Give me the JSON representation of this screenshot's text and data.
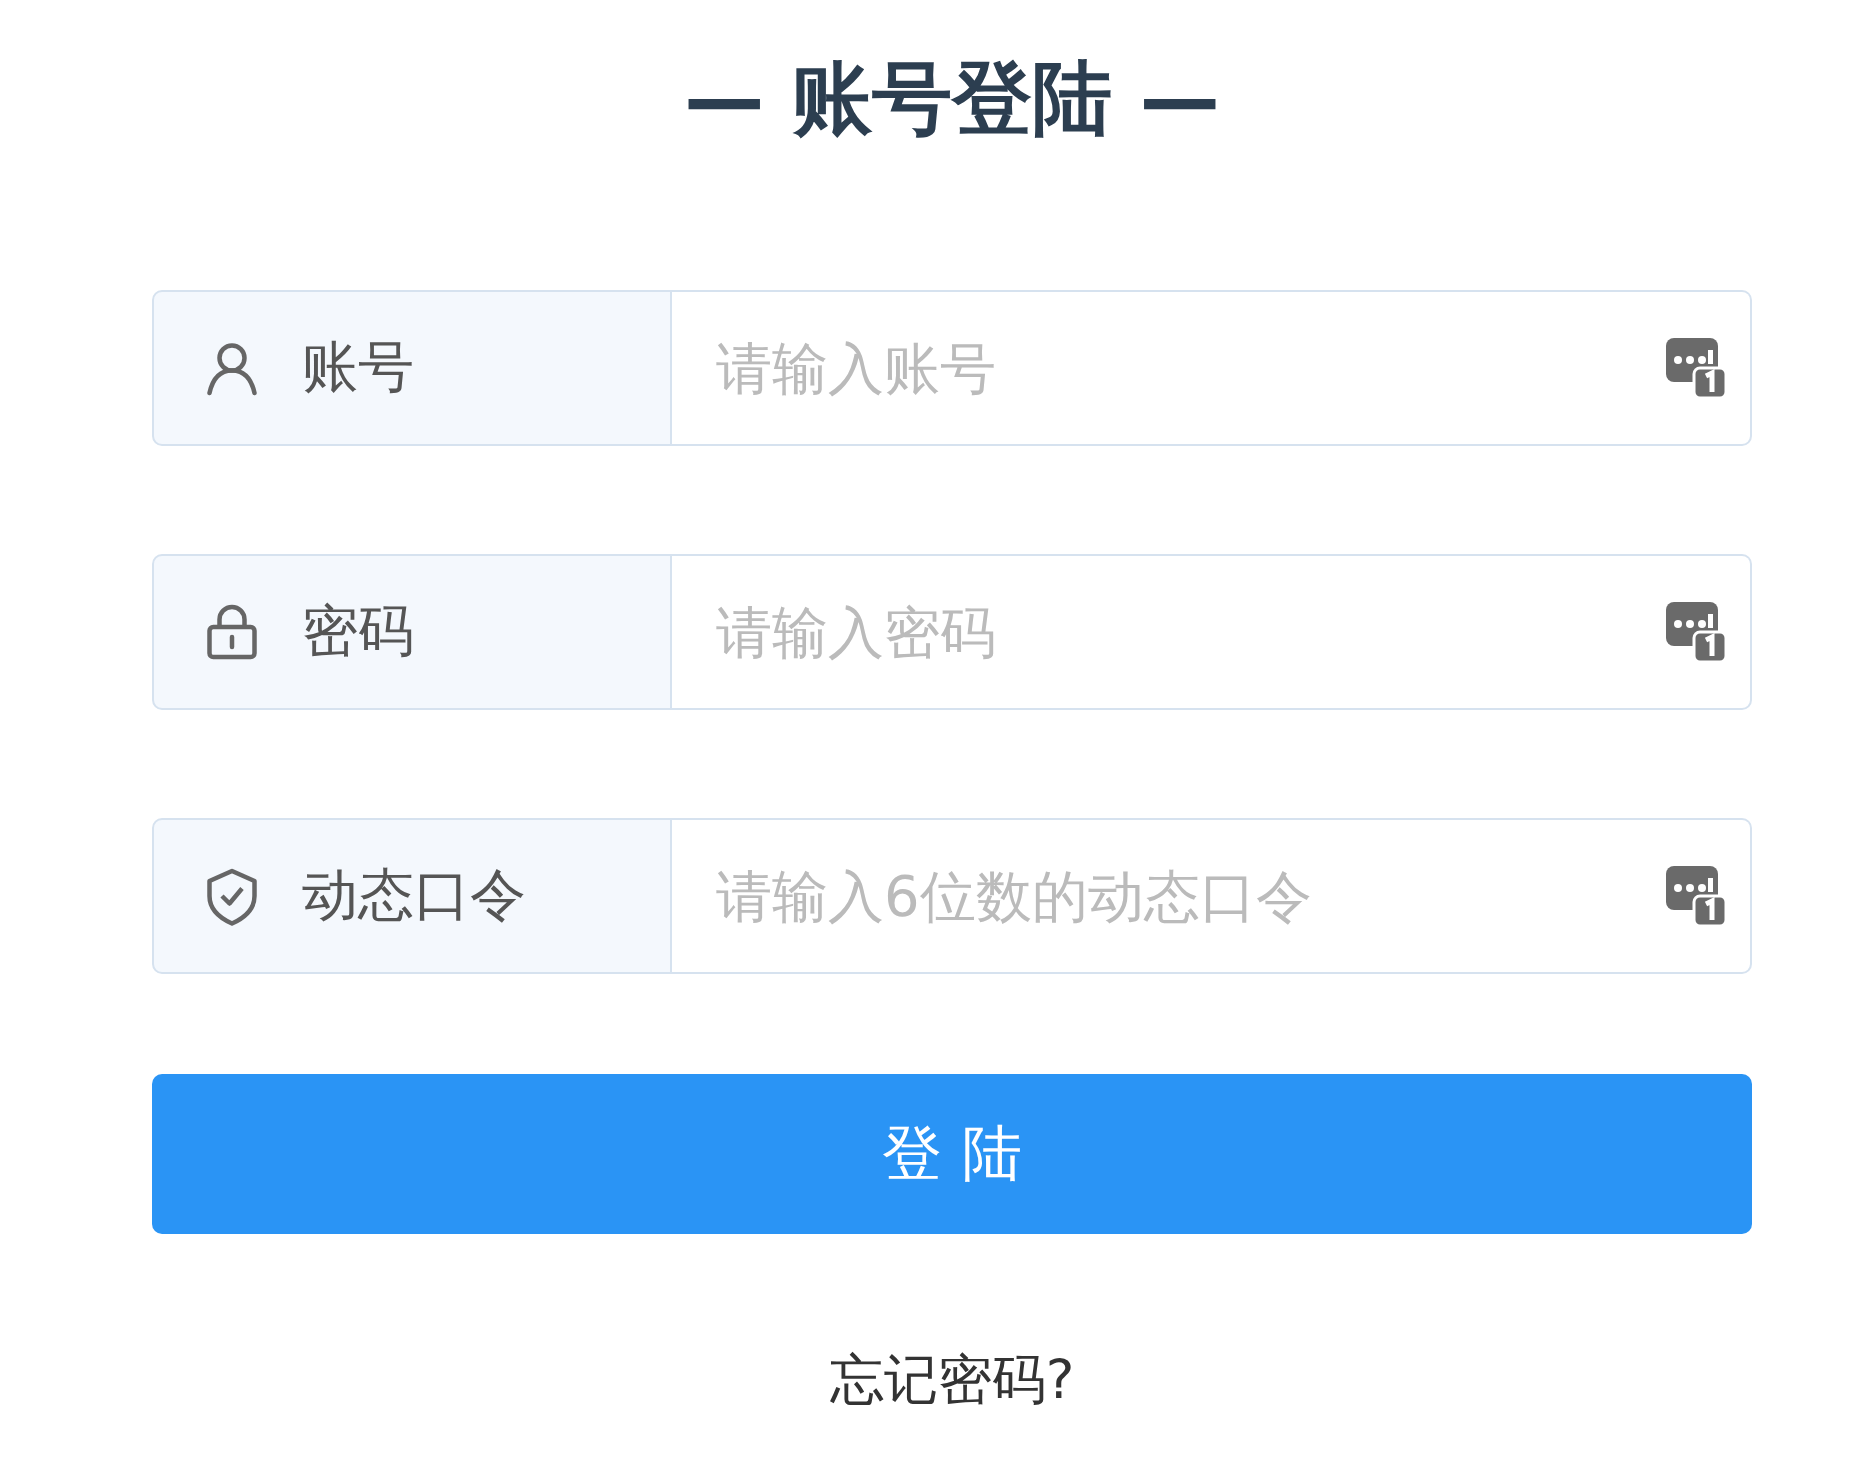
{
  "title": "— 账号登陆 —",
  "fields": [
    {
      "label": "账号",
      "placeholder": "请输入账号"
    },
    {
      "label": "密码",
      "placeholder": "请输入密码"
    },
    {
      "label": "动态口令",
      "placeholder": "请输入6位数的动态口令"
    }
  ],
  "submit_button": "登 陆",
  "forgot_link": "忘记密码?"
}
